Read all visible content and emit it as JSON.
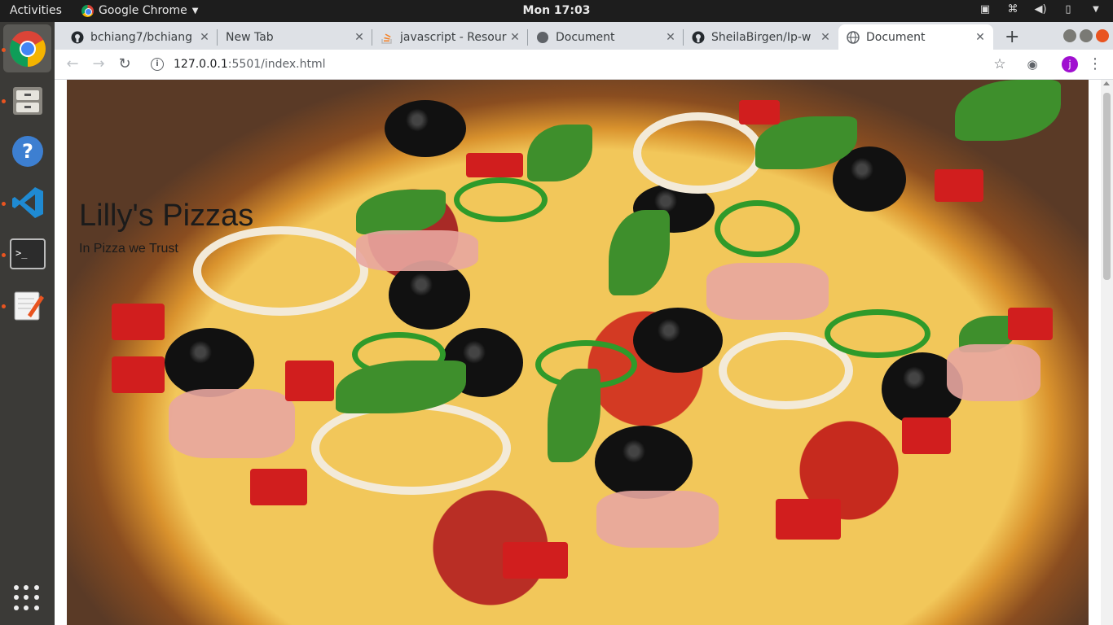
{
  "system": {
    "activities": "Activities",
    "app_menu": "Google Chrome",
    "clock": "Mon 17:03"
  },
  "dock": {
    "items": [
      "chrome",
      "files",
      "help",
      "vscode",
      "terminal",
      "text-editor"
    ],
    "show_apps_icon": "grid-icon"
  },
  "browser": {
    "tabs": [
      {
        "label": "bchiang7/bchiang",
        "icon": "github-icon"
      },
      {
        "label": "New Tab",
        "icon": ""
      },
      {
        "label": "javascript - Resour",
        "icon": "stackoverflow-icon"
      },
      {
        "label": "Document",
        "icon": "globe-icon"
      },
      {
        "label": "SheilaBirgen/Ip-w",
        "icon": "github-icon"
      },
      {
        "label": "Document",
        "icon": "globe-icon",
        "active": true
      }
    ],
    "url_host": "127.0.0.1",
    "url_path": ":5501/index.html",
    "profile_initial": "j",
    "colors": {
      "profile": "#a010d0",
      "tab_active": "#ffffff",
      "tabstrip": "#dee1e6"
    }
  },
  "page": {
    "title": "Lilly's Pizzas",
    "tagline": "In Pizza we Trust"
  }
}
